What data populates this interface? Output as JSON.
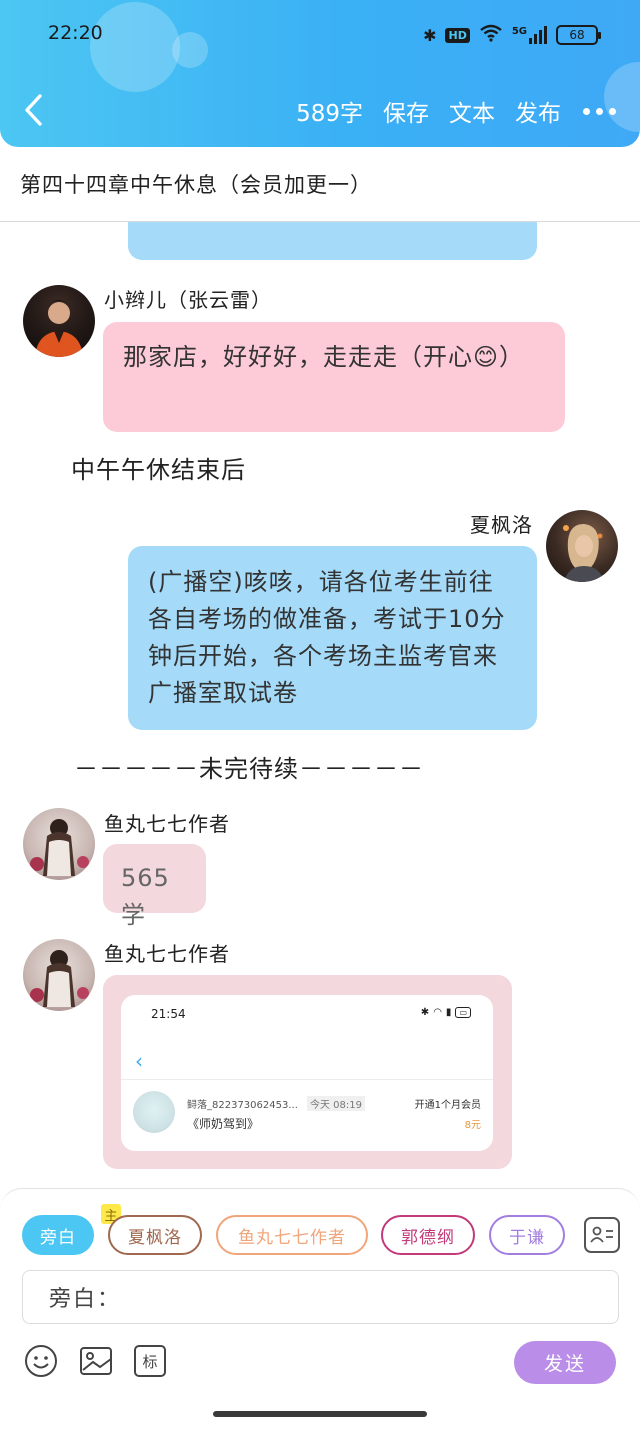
{
  "status_bar": {
    "time": "22:20",
    "bluetooth_icon": "bluetooth-icon",
    "hd": "HD",
    "wifi_icon": "wifi-icon",
    "signal": "5G",
    "battery": "68"
  },
  "header": {
    "word_count": "589字",
    "save": "保存",
    "text": "文本",
    "publish": "发布",
    "back_icon": "chevron-left-icon",
    "more_icon": "more-dots-icon"
  },
  "chapter_title": "第四十四章中午休息（会员加更一）",
  "messages": [
    {
      "speaker": "小辫儿（张云雷）",
      "text": "那家店，好好好，走走走（开心😊）"
    },
    {
      "narration": "中午午休结束后"
    },
    {
      "speaker": "夏枫洛",
      "text": "(广播空)咳咳，请各位考生前往各自考场的做准备，考试于10分钟后开始，各个考场主监考官来广播室取试卷"
    },
    {
      "narration": "－－－－－未完待续－－－－－"
    },
    {
      "speaker": "鱼丸七七作者",
      "text": "565学"
    },
    {
      "speaker": "鱼丸七七作者",
      "image": {
        "time": "21:54",
        "user": "鲟落_822373062453...",
        "date": "今天 08:19",
        "book": "《师奶驾到》",
        "vip": "开通1个月会员",
        "price": "8元"
      }
    }
  ],
  "composer": {
    "chips": [
      "旁白",
      "夏枫洛",
      "鱼丸七七作者",
      "郭德纲",
      "于谦"
    ],
    "host_tag": "主",
    "input_prefix": "旁白：",
    "send": "发送",
    "tools": [
      "emoji-icon",
      "image-icon",
      "tag-icon"
    ],
    "contact_icon": "contact-card-icon"
  },
  "colors": {
    "header": "#3ab0f5",
    "blue_bubble": "#a5dbf8",
    "pink_bubble": "#fdcbd7",
    "send_button": "#b98de8"
  }
}
